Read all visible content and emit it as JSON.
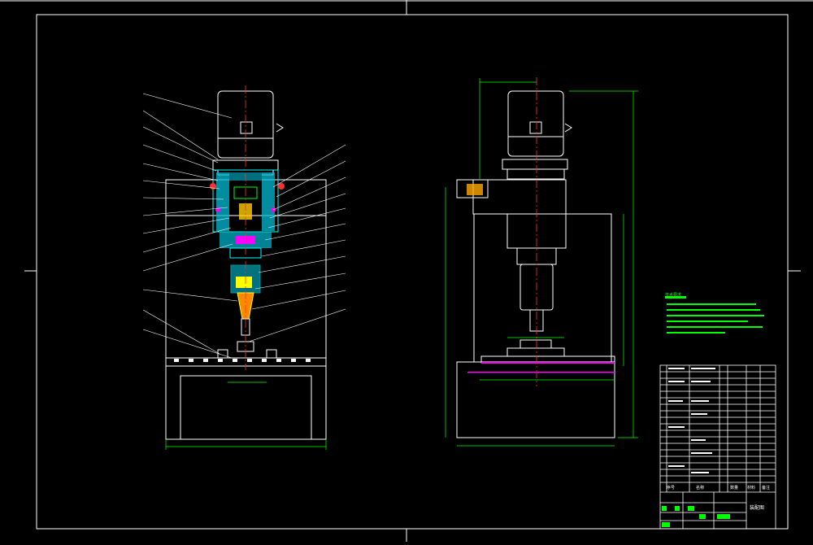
{
  "drawing": {
    "background": "#000000",
    "colors": {
      "frame": "#ffffff",
      "centerline": "#ff3030",
      "dimension": "#00ff00",
      "body": "#ffffff",
      "hatch": "#00ffff",
      "highlight": "#ff00ff",
      "notes": "#00ff00",
      "yellow": "#ffff00"
    },
    "title_block": {
      "header_labels": [
        "序号",
        "名称",
        "数量",
        "材料",
        "备注"
      ],
      "drawing_title": "装配图"
    },
    "notes_heading": "技术要求"
  }
}
